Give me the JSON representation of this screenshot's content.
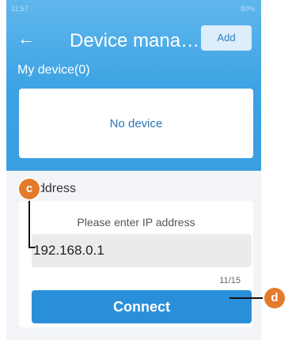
{
  "status_bar": {
    "time": "11:57",
    "right_info": "80%"
  },
  "header": {
    "title": "Device mana…",
    "add_label": "Add",
    "back_icon": "arrow-left-icon"
  },
  "devices": {
    "section_title": "My device(0)",
    "empty_text": "No device"
  },
  "address": {
    "label": "ddress",
    "hint": "Please enter IP address",
    "value": "192.168.0.1",
    "counter": "11/15"
  },
  "connect_label": "Connect",
  "callouts": {
    "c": "c",
    "d": "d"
  },
  "colors": {
    "accent": "#2a8fd9",
    "header_gradient_top": "#5fb6ec",
    "callout": "#e47a2b"
  }
}
